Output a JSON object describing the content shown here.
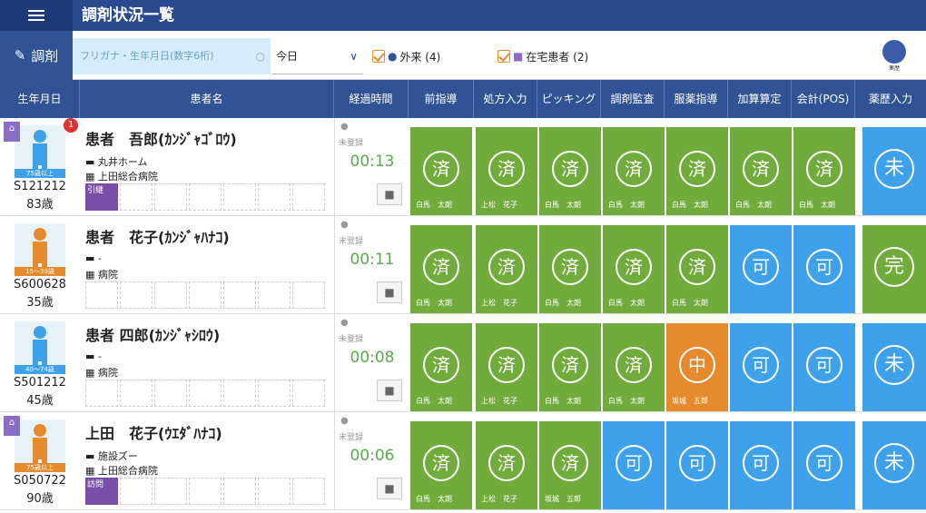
{
  "app": {
    "title": "調剤状況一覧"
  },
  "filters": {
    "mode_label": "調剤",
    "search_placeholder": "フリガナ・生年月日(数字6桁)",
    "date_value": "今日",
    "outpatient_label": "外来 (4)",
    "home_label": "在宅患者 (2)",
    "kusuri_label": "薬歴"
  },
  "columns": [
    "生年月日",
    "患者名",
    "経過時間",
    "前指導",
    "処方入力",
    "ピッキング",
    "調剤監査",
    "服薬指導",
    "加算算定",
    "会計(POS)",
    "薬歴入力"
  ],
  "status_unregistered": "未登録",
  "patients": [
    {
      "id": "S121212",
      "age": "83歳",
      "age_band": "75歳以上",
      "name": "患者　吾郎(ｶﾝｼﾞｬｺﾞﾛｳ)",
      "facility": "丸井ホーム",
      "hospital": "上田総合病院",
      "elapsed": "00:13",
      "tag": "引継",
      "badge": "1",
      "steps": [
        {
          "s": "済",
          "w": "白馬　太朗",
          "c": "green"
        },
        {
          "s": "済",
          "w": "上松　花子",
          "c": "green"
        },
        {
          "s": "済",
          "w": "白馬　太朗",
          "c": "green"
        },
        {
          "s": "済",
          "w": "白馬　太朗",
          "c": "green"
        },
        {
          "s": "済",
          "w": "白馬　太朗",
          "c": "green"
        },
        {
          "s": "済",
          "w": "白馬　太朗",
          "c": "green"
        },
        {
          "s": "済",
          "w": "白馬　太朗",
          "c": "green"
        }
      ],
      "yaku": "未"
    },
    {
      "id": "S600628",
      "age": "35歳",
      "age_band": "15〜39歳",
      "name": "患者　花子(ｶﾝｼﾞｬﾊﾅｺ)",
      "facility": "-",
      "hospital": "病院",
      "elapsed": "00:11",
      "tag": "",
      "badge": "",
      "steps": [
        {
          "s": "済",
          "w": "白馬　太朗",
          "c": "green"
        },
        {
          "s": "済",
          "w": "上松　花子",
          "c": "green"
        },
        {
          "s": "済",
          "w": "白馬　太朗",
          "c": "green"
        },
        {
          "s": "済",
          "w": "白馬　太朗",
          "c": "green"
        },
        {
          "s": "済",
          "w": "白馬　太朗",
          "c": "green"
        },
        {
          "s": "可",
          "w": "",
          "c": "blue"
        },
        {
          "s": "可",
          "w": "",
          "c": "blue"
        }
      ],
      "yaku": "完"
    },
    {
      "id": "S501212",
      "age": "45歳",
      "age_band": "40〜74歳",
      "name": "患者 四郎(ｶﾝｼﾞｬｼﾛｳ)",
      "facility": "-",
      "hospital": "病院",
      "elapsed": "00:08",
      "tag": "",
      "badge": "",
      "steps": [
        {
          "s": "済",
          "w": "白馬　太朗",
          "c": "green"
        },
        {
          "s": "済",
          "w": "上松　花子",
          "c": "green"
        },
        {
          "s": "済",
          "w": "白馬　太朗",
          "c": "green"
        },
        {
          "s": "済",
          "w": "白馬　太朗",
          "c": "green"
        },
        {
          "s": "中",
          "w": "坂城　五郎",
          "c": "orange"
        },
        {
          "s": "可",
          "w": "",
          "c": "blue"
        },
        {
          "s": "可",
          "w": "",
          "c": "blue"
        }
      ],
      "yaku": "未"
    },
    {
      "id": "S050722",
      "age": "90歳",
      "age_band": "75歳以上",
      "name": "上田　花子(ｳｴﾀﾞﾊﾅｺ)",
      "facility": "施設ズー",
      "hospital": "上田総合病院",
      "elapsed": "00:06",
      "tag": "訪問",
      "badge": "",
      "steps": [
        {
          "s": "済",
          "w": "白馬　太朗",
          "c": "green"
        },
        {
          "s": "済",
          "w": "上松　花子",
          "c": "green"
        },
        {
          "s": "済",
          "w": "坂城　五郎",
          "c": "green"
        },
        {
          "s": "可",
          "w": "",
          "c": "blue"
        },
        {
          "s": "可",
          "w": "",
          "c": "blue"
        },
        {
          "s": "可",
          "w": "",
          "c": "blue"
        },
        {
          "s": "可",
          "w": "",
          "c": "blue"
        }
      ],
      "yaku": "未"
    }
  ],
  "colors": {
    "header": "#294a8e",
    "done": "#70ab3c",
    "ready": "#3fa1ea",
    "progress": "#e68a2e"
  }
}
